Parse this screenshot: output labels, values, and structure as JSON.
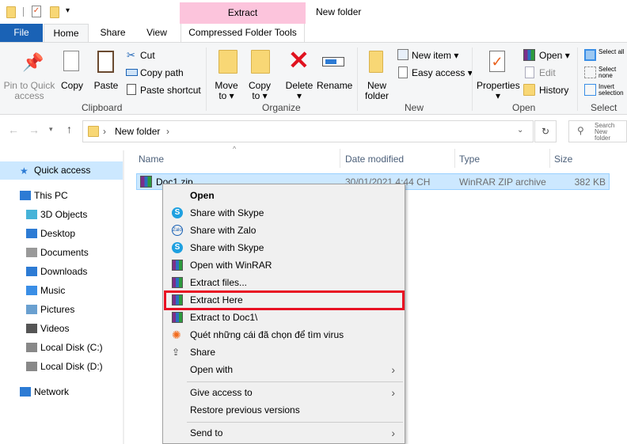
{
  "title": "New folder",
  "context_tab": {
    "group": "Extract",
    "label": "Compressed Folder Tools",
    "color": "#fcc4dc"
  },
  "tabs": [
    "File",
    "Home",
    "Share",
    "View"
  ],
  "ribbon": {
    "clipboard": {
      "pin": "Pin to Quick access",
      "copy": "Copy",
      "paste": "Paste",
      "cut": "Cut",
      "copy_path": "Copy path",
      "paste_shortcut": "Paste shortcut",
      "group": "Clipboard"
    },
    "organize": {
      "move": "Move",
      "move2": "to",
      "copy": "Copy",
      "copy2": "to",
      "delete": "Delete",
      "rename": "Rename",
      "group": "Organize"
    },
    "new": {
      "new_folder": "New",
      "new_folder2": "folder",
      "new_item": "New item",
      "easy_access": "Easy access",
      "group": "New"
    },
    "open": {
      "properties": "Properties",
      "open": "Open",
      "edit": "Edit",
      "history": "History",
      "group": "Open"
    },
    "select": {
      "select_all": "Select all",
      "select_none": "Select none",
      "invert": "Invert selection",
      "group": "Select"
    }
  },
  "address": {
    "path": "New folder",
    "search_placeholder": "Search New folder"
  },
  "nav": [
    "Quick access",
    "This PC",
    "3D Objects",
    "Desktop",
    "Documents",
    "Downloads",
    "Music",
    "Pictures",
    "Videos",
    "Local Disk (C:)",
    "Local Disk (D:)",
    "Network"
  ],
  "columns": [
    "Name",
    "Date modified",
    "Type",
    "Size"
  ],
  "files": [
    {
      "name": "Doc1.zip",
      "date": "30/01/2021 4:44 CH",
      "type": "WinRAR ZIP archive",
      "size": "382 KB"
    }
  ],
  "menu": [
    "Open",
    "Share with Skype",
    "Share with Zalo",
    "Share with Skype",
    "Open with WinRAR",
    "Extract files...",
    "Extract Here",
    "Extract to Doc1\\",
    "Quét những cái đã chọn để tìm virus",
    "Share",
    "Open with",
    "Give access to",
    "Restore previous versions",
    "Send to"
  ],
  "highlight_color": "#e81123"
}
